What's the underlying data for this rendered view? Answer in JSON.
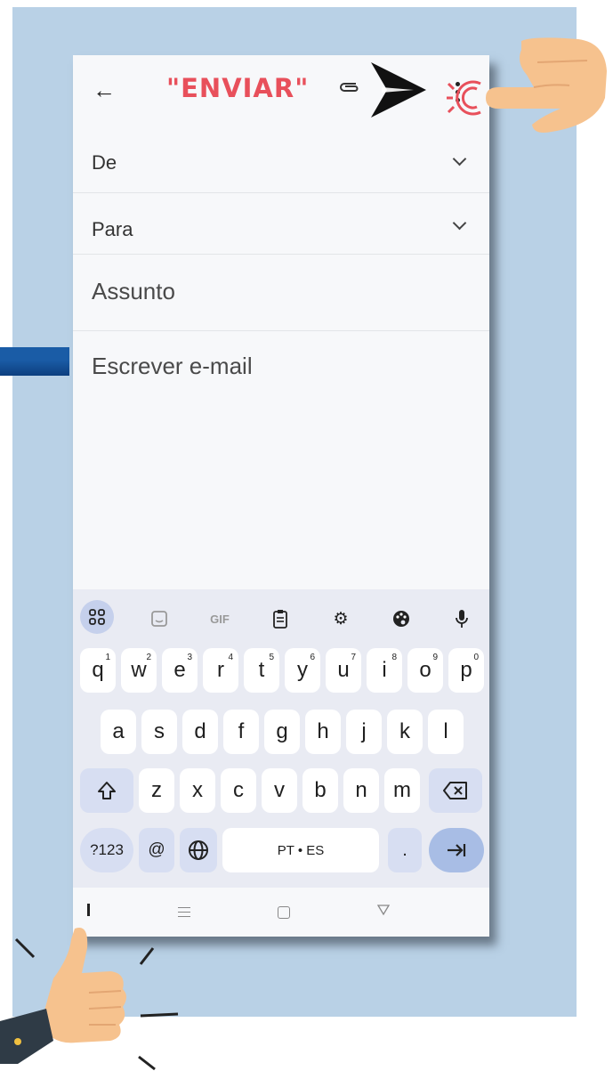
{
  "header": {
    "back_icon": "arrow-left-icon",
    "title": "\"ENVIAR\"",
    "attach_icon": "paperclip-icon",
    "send_arrow": "send-arrow-icon",
    "menu_icon": "more-vert-icon"
  },
  "fields": {
    "from": "De",
    "to": "Para",
    "subject": "Assunto",
    "body_placeholder": "Escrever e-mail"
  },
  "keyboard": {
    "toolbar": [
      "apps-icon",
      "sticker-icon",
      "GIF",
      "clipboard-icon",
      "settings-icon",
      "palette-icon",
      "mic-icon"
    ],
    "row1": [
      {
        "k": "q",
        "n": "1"
      },
      {
        "k": "w",
        "n": "2"
      },
      {
        "k": "e",
        "n": "3"
      },
      {
        "k": "r",
        "n": "4"
      },
      {
        "k": "t",
        "n": "5"
      },
      {
        "k": "y",
        "n": "6"
      },
      {
        "k": "u",
        "n": "7"
      },
      {
        "k": "i",
        "n": "8"
      },
      {
        "k": "o",
        "n": "9"
      },
      {
        "k": "p",
        "n": "0"
      }
    ],
    "row2": [
      "a",
      "s",
      "d",
      "f",
      "g",
      "h",
      "j",
      "k",
      "l"
    ],
    "row3": [
      "z",
      "x",
      "c",
      "v",
      "b",
      "n",
      "m"
    ],
    "sym": "?123",
    "at": "@",
    "space": "PT • ES",
    "dot": "."
  },
  "colors": {
    "accent": "#e8505b",
    "background": "#b9d1e6",
    "enter": "#a8bde5",
    "mod": "#d7def2"
  }
}
